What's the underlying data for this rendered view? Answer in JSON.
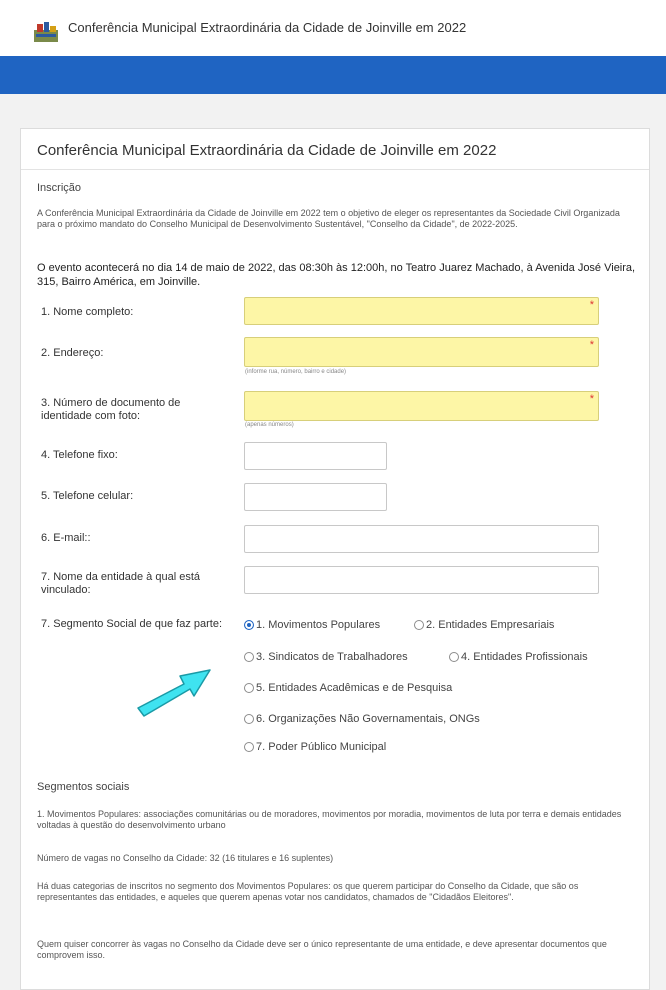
{
  "header": {
    "site_title": "Conferência Municipal Extraordinária da Cidade de Joinville em 2022"
  },
  "card": {
    "title": "Conferência Municipal Extraordinária da Cidade de Joinville em 2022",
    "section": "Inscrição",
    "intro": "A Conferência Municipal Extraordinária da Cidade de Joinville em 2022 tem o objetivo de eleger os representantes da Sociedade Civil Organizada para o próximo mandato do Conselho Municipal de Desenvolvimento Sustentável, \"Conselho da Cidade\", de 2022-2025.",
    "event": "O evento acontecerá no dia 14 de maio de 2022, das 08:30h às 12:00h, no Teatro Juarez Machado, à Avenida José Vieira, 315, Bairro América, em Joinville."
  },
  "form": {
    "nome_label": "1. Nome completo:",
    "endereco_label": "2. Endereço:",
    "endereco_hint": "(informe rua, número, bairro e cidade)",
    "documento_label": "3. Número de documento de identidade com foto:",
    "documento_hint": "(apenas números)",
    "telefone_fixo_label": "4. Telefone fixo:",
    "telefone_celular_label": "5. Telefone celular:",
    "email_label": "6. E-mail::",
    "entidade_label": "7. Nome da entidade à qual está vinculado:",
    "segmento_label": "7. Segmento Social de que faz parte:",
    "required_mark": "*",
    "segment_options": [
      "1. Movimentos Populares",
      "2. Entidades Empresariais",
      "3. Sindicatos de Trabalhadores",
      "4. Entidades Profissionais",
      "5. Entidades Acadêmicas e de Pesquisa",
      "6. Organizações Não Governamentais, ONGs",
      "7. Poder Público Municipal"
    ],
    "selected_segment": "1. Movimentos Populares"
  },
  "segmentos": {
    "heading": "Segmentos sociais",
    "p1": "1. Movimentos Populares: associações comunitárias ou de moradores, movimentos por moradia, movimentos de luta por terra e demais entidades voltadas à questão do desenvolvimento urbano",
    "p2": "Número de vagas no Conselho da Cidade: 32 (16 titulares e 16 suplentes)",
    "p3": "Há duas categorias de inscritos no segmento dos Movimentos Populares: os que querem participar do Conselho da Cidade, que são os representantes das entidades, e aqueles que querem apenas votar nos candidatos, chamados de \"Cidadãos Eleitores\".",
    "p4": "Quem quiser concorrer às vagas no Conselho da Cidade deve ser o único representante de uma entidade, e deve apresentar documentos que comprovem isso."
  },
  "colors": {
    "brand_blue": "#1f64c2",
    "required_yellow": "#fdf6a6",
    "arrow_cyan": "#3fe3f0"
  },
  "icons": [
    "city-logo-icon",
    "pointer-arrow-icon"
  ]
}
